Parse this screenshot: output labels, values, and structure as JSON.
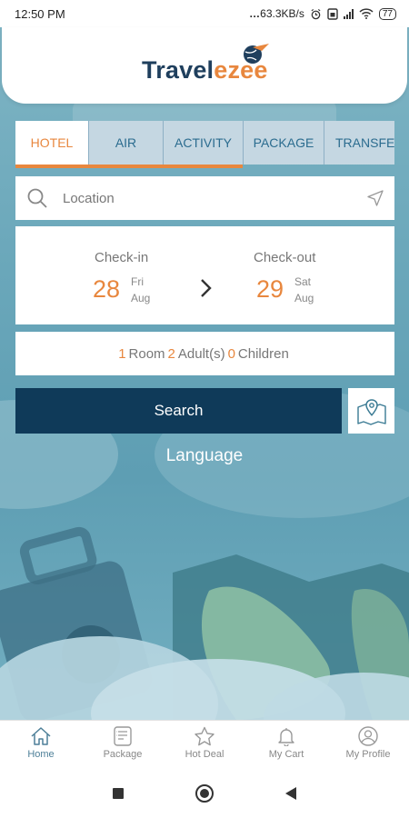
{
  "status_bar": {
    "time": "12:50 PM",
    "speed": "63.3KB/s",
    "battery": "77"
  },
  "brand": {
    "part1": "Travel",
    "part2": "ezee"
  },
  "tabs": [
    {
      "label": "HOTEL"
    },
    {
      "label": "AIR"
    },
    {
      "label": "ACTIVITY"
    },
    {
      "label": "PACKAGE"
    },
    {
      "label": "TRANSFE"
    }
  ],
  "location": {
    "placeholder": "Location"
  },
  "checkin": {
    "label": "Check-in",
    "day": "28",
    "weekday": "Fri",
    "month": "Aug"
  },
  "checkout": {
    "label": "Check-out",
    "day": "29",
    "weekday": "Sat",
    "month": "Aug"
  },
  "guests": {
    "rooms": "1",
    "rooms_label": "Room",
    "adults": "2",
    "adults_label": "Adult(s)",
    "children": "0",
    "children_label": "Children"
  },
  "search_label": "Search",
  "language_label": "Language",
  "bottom_nav": [
    {
      "label": "Home",
      "icon": "home-icon"
    },
    {
      "label": "Package",
      "icon": "package-icon"
    },
    {
      "label": "Hot Deal",
      "icon": "star-icon"
    },
    {
      "label": "My Cart",
      "icon": "bell-icon"
    },
    {
      "label": "My Profile",
      "icon": "profile-icon"
    }
  ],
  "colors": {
    "accent": "#e8873e",
    "primary": "#0f3a59",
    "tab_bg": "#c5d7e2"
  }
}
